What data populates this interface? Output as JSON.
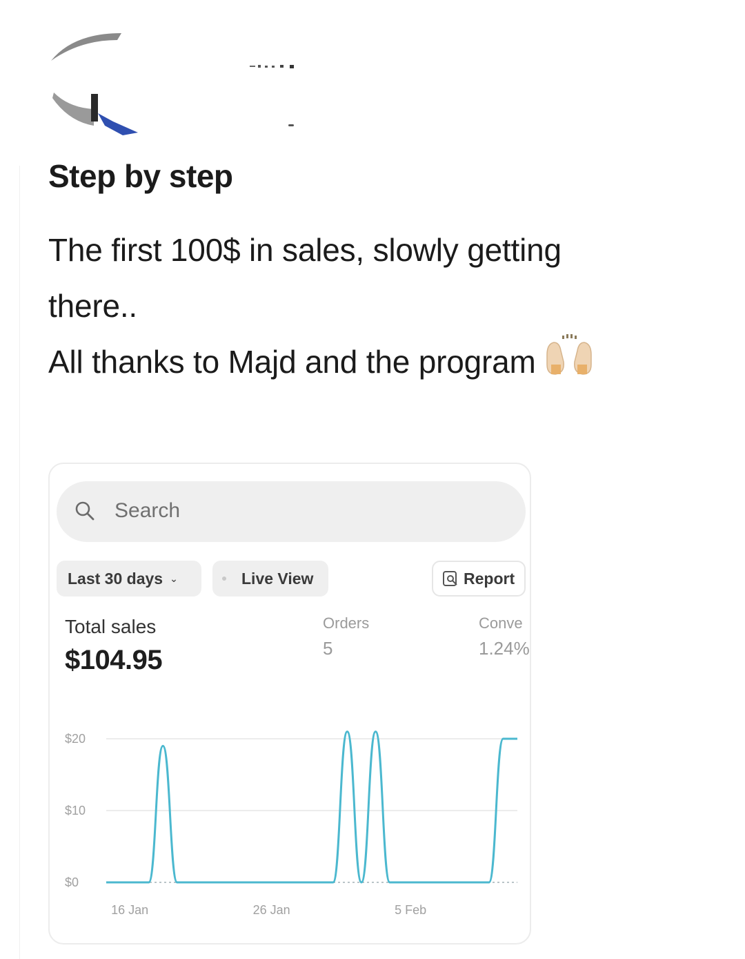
{
  "post": {
    "title": "Step by step",
    "body_lines": [
      "The first 100$ in sales, slowly getting",
      "there..",
      "All thanks to Majd and the program"
    ],
    "emoji_icon": "raising-hands-icon"
  },
  "dashboard": {
    "search": {
      "placeholder": "Search"
    },
    "filters": {
      "period_label": "Last 30 days",
      "live_view_label": "Live View",
      "report_label": "Report"
    },
    "metrics": {
      "total_sales_label": "Total sales",
      "total_sales_value": "$104.95",
      "orders_label": "Orders",
      "orders_value": "5",
      "conversion_label": "Conve",
      "conversion_value": "1.24%"
    }
  },
  "chart_data": {
    "type": "line",
    "color": "#4bb8cf",
    "ylim": [
      0,
      20
    ],
    "y_ticks": [
      "$0",
      "$10",
      "$20"
    ],
    "x_ticks": [
      "16 Jan",
      "26 Jan",
      "5 Feb"
    ],
    "series": [
      {
        "values": [
          [
            "14 Jan",
            0
          ],
          [
            "17 Jan",
            0
          ],
          [
            "18 Jan",
            19
          ],
          [
            "19 Jan",
            0
          ],
          [
            "30 Jan",
            0
          ],
          [
            "31 Jan",
            21
          ],
          [
            "1 Feb",
            0
          ],
          [
            "2 Feb",
            21
          ],
          [
            "3 Feb",
            0
          ],
          [
            "10 Feb",
            0
          ],
          [
            "11 Feb",
            20
          ],
          [
            "12 Feb",
            20
          ]
        ]
      }
    ]
  }
}
